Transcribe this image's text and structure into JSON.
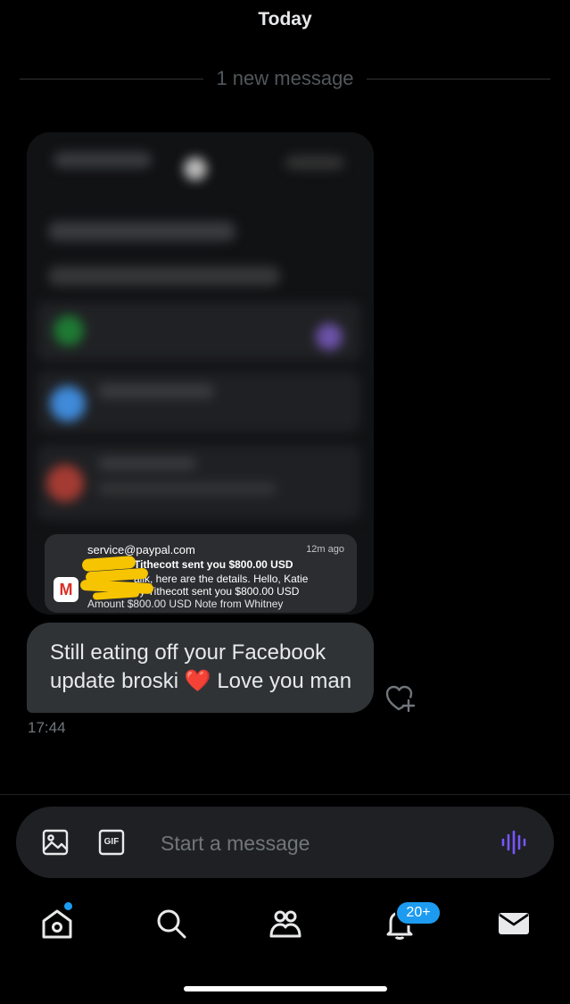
{
  "header": {
    "date_label": "Today"
  },
  "divider": {
    "label": "1 new message"
  },
  "attachment": {
    "notification": {
      "from": "service@paypal.com",
      "time": "12m ago",
      "line1": "Tithecott sent you $800.00 USD",
      "line2": "alik, here are the details. Hello, Katie",
      "line3": "ey Tithecott sent you $800.00 USD",
      "line4": "Amount $800.00 USD Note from Whitney",
      "app_icon": "gmail-icon"
    }
  },
  "message": {
    "line1": "Still eating off your Facebook",
    "line2_before": "update broski ",
    "emoji": "❤️",
    "line2_after": " Love you man",
    "timestamp": "17:44",
    "react_icon": "heart-plus-icon"
  },
  "composer": {
    "placeholder": "Start a message",
    "gif_label": "GIF",
    "icons": [
      "image-icon",
      "gif-icon",
      "voice-icon"
    ]
  },
  "tabbar": {
    "items": [
      "home",
      "search",
      "communities",
      "notifications",
      "messages"
    ],
    "notifications_badge": "20+",
    "home_has_dot": true
  },
  "colors": {
    "accent": "#1d9bf0",
    "bubble": "#2f3336",
    "voice_icon": "#7856ff",
    "background": "#000000"
  }
}
